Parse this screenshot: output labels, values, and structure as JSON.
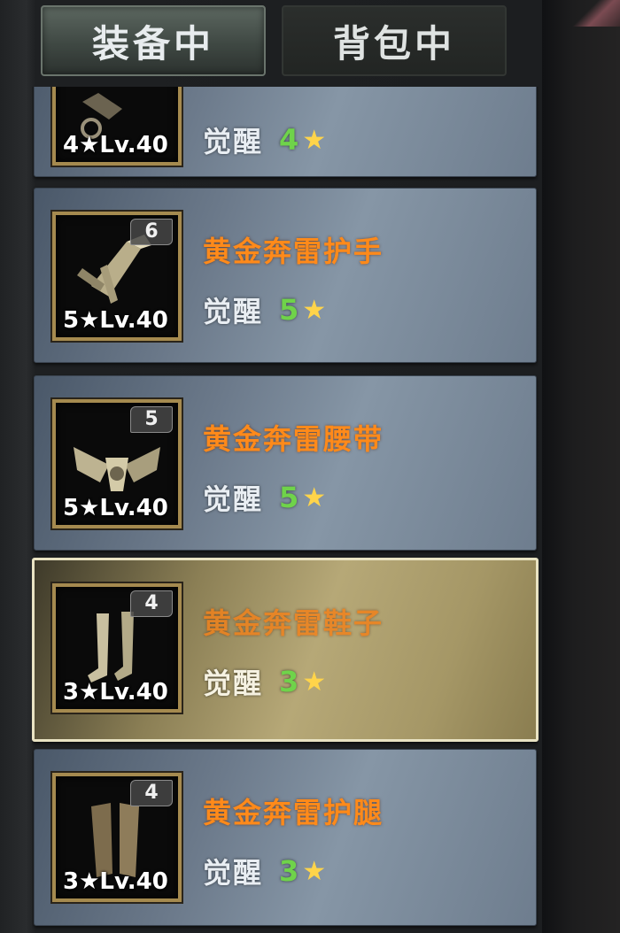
{
  "tabs": {
    "equipped": "装备中",
    "backpack": "背包中"
  },
  "awaken_label": "觉醒",
  "star_glyph": "★",
  "items": [
    {
      "name": "",
      "count": "",
      "level_caption": "4★Lv.40",
      "awaken_level": "4",
      "selected": false
    },
    {
      "name": "黄金奔雷护手",
      "count": "6",
      "level_caption": "5★Lv.40",
      "awaken_level": "5",
      "selected": false
    },
    {
      "name": "黄金奔雷腰带",
      "count": "5",
      "level_caption": "5★Lv.40",
      "awaken_level": "5",
      "selected": false
    },
    {
      "name": "黄金奔雷鞋子",
      "count": "4",
      "level_caption": "3★Lv.40",
      "awaken_level": "3",
      "selected": true
    },
    {
      "name": "黄金奔雷护腿",
      "count": "4",
      "level_caption": "3★Lv.40",
      "awaken_level": "3",
      "selected": false
    }
  ],
  "colors": {
    "item_name": "#ff8a1a",
    "awaken_number": "#6fd34a",
    "star": "#ffd44a",
    "icon_frame": "#a58a4f",
    "selected_border": "#e9e3c3"
  }
}
